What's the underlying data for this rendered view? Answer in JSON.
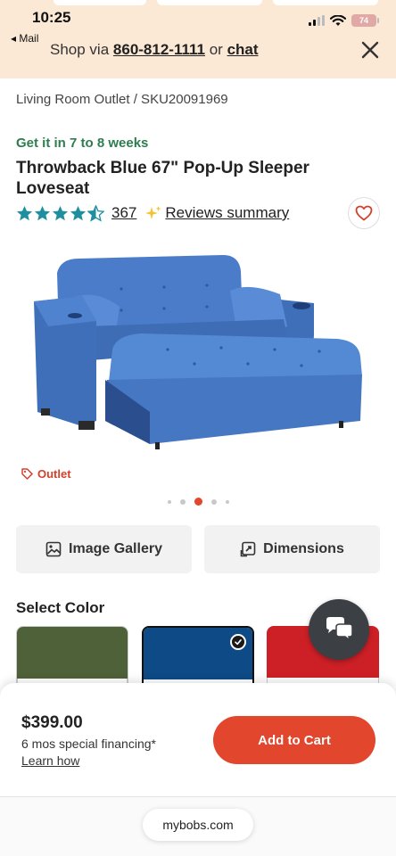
{
  "status_bar": {
    "time": "10:25",
    "battery": "74",
    "back_app": "◂ Mail"
  },
  "banner": {
    "prefix": "Shop via",
    "phone": "860-812-1111",
    "or": "or",
    "chat": "chat"
  },
  "breadcrumb": "Living Room Outlet /  SKU20091969",
  "product": {
    "delivery": "Get it in 7 to 8 weeks",
    "title": "Throwback Blue 67\" Pop-Up Sleeper Loveseat",
    "rating": 4.5,
    "review_count": "367",
    "reviews_summary": "Reviews summary",
    "outlet_badge": "Outlet"
  },
  "gallery": {
    "slide_count": 5,
    "active_slide": 3
  },
  "buttons": {
    "image_gallery": "Image Gallery",
    "dimensions": "Dimensions"
  },
  "colors": {
    "heading": "Select Color",
    "swatches": [
      {
        "name": "green",
        "hex": "#4f6139",
        "selected": false
      },
      {
        "name": "blue",
        "hex": "#0d4a86",
        "selected": true
      },
      {
        "name": "red",
        "hex": "#cc2026",
        "selected": false
      }
    ]
  },
  "cart": {
    "price": "$399.00",
    "financing": "6 mos special financing*",
    "learn_how": "Learn how",
    "add_to_cart": "Add to Cart"
  },
  "browser": {
    "url": "mybobs.com"
  },
  "theme": {
    "accent": "#e2462d",
    "banner_bg": "#fbe9d6",
    "delivery_green": "#2e7d4f",
    "star": "#1f8fa0"
  }
}
